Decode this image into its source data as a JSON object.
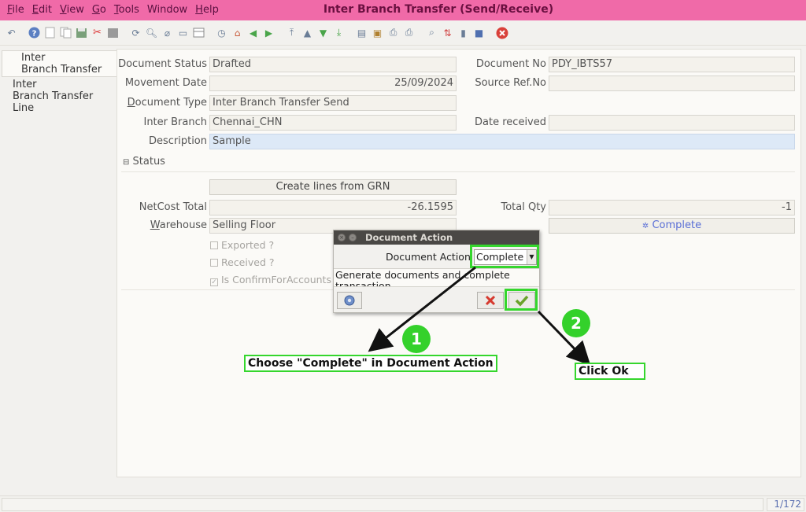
{
  "window": {
    "title": "Inter Branch Transfer (Send/Receive)"
  },
  "menu": [
    {
      "first": "F",
      "rest": "ile"
    },
    {
      "first": "E",
      "rest": "dit"
    },
    {
      "first": "V",
      "rest": "iew"
    },
    {
      "first": "G",
      "rest": "o"
    },
    {
      "first": "T",
      "rest": "ools"
    },
    {
      "first": "",
      "rest": "Window"
    },
    {
      "first": "H",
      "rest": "elp"
    }
  ],
  "tabs": {
    "header": [
      "Inter",
      "Branch Transfer"
    ],
    "lines": [
      "Inter",
      "Branch Transfer Line"
    ]
  },
  "form": {
    "document_status": {
      "label": "Document Status",
      "value": "Drafted"
    },
    "document_no": {
      "label": "Document No",
      "value": "PDY_IBTS57"
    },
    "movement_date": {
      "label": "Movement Date",
      "value": "25/09/2024"
    },
    "source_ref": {
      "label": "Source Ref.No",
      "value": ""
    },
    "document_type": {
      "label_first": "D",
      "label_rest": "ocument Type",
      "value": "Inter Branch Transfer Send"
    },
    "inter_branch": {
      "label": "Inter Branch",
      "value": "Chennai_CHN"
    },
    "date_received": {
      "label": "Date received",
      "value": ""
    },
    "description": {
      "label": "Description",
      "value": "Sample"
    }
  },
  "status_section": {
    "header": "Status",
    "create_lines_button": "Create lines from GRN",
    "netcost_total": {
      "label": "NetCost Total",
      "value": "-26.1595"
    },
    "total_qty": {
      "label": "Total Qty",
      "value": "-1"
    },
    "warehouse": {
      "label_first": "W",
      "label_rest": "arehouse",
      "value": "Selling Floor"
    },
    "complete_button": "Complete",
    "exported": "Exported ?",
    "received": "Received ?",
    "confirm": "Is ConfirmForAccounts"
  },
  "dialog": {
    "title": "Document Action",
    "field_label": "Document Action",
    "selected": "Complete",
    "description": "Generate documents and complete transaction"
  },
  "annotations": {
    "step1_number": "1",
    "step1_text": "Choose \"Complete\" in Document Action",
    "step2_number": "2",
    "step2_text": "Click Ok"
  },
  "status_bar": {
    "record": "1/172"
  },
  "colors": {
    "title_bar": "#f06aa8",
    "highlight": "#35d62d",
    "field_blue": "#dde9f7"
  }
}
